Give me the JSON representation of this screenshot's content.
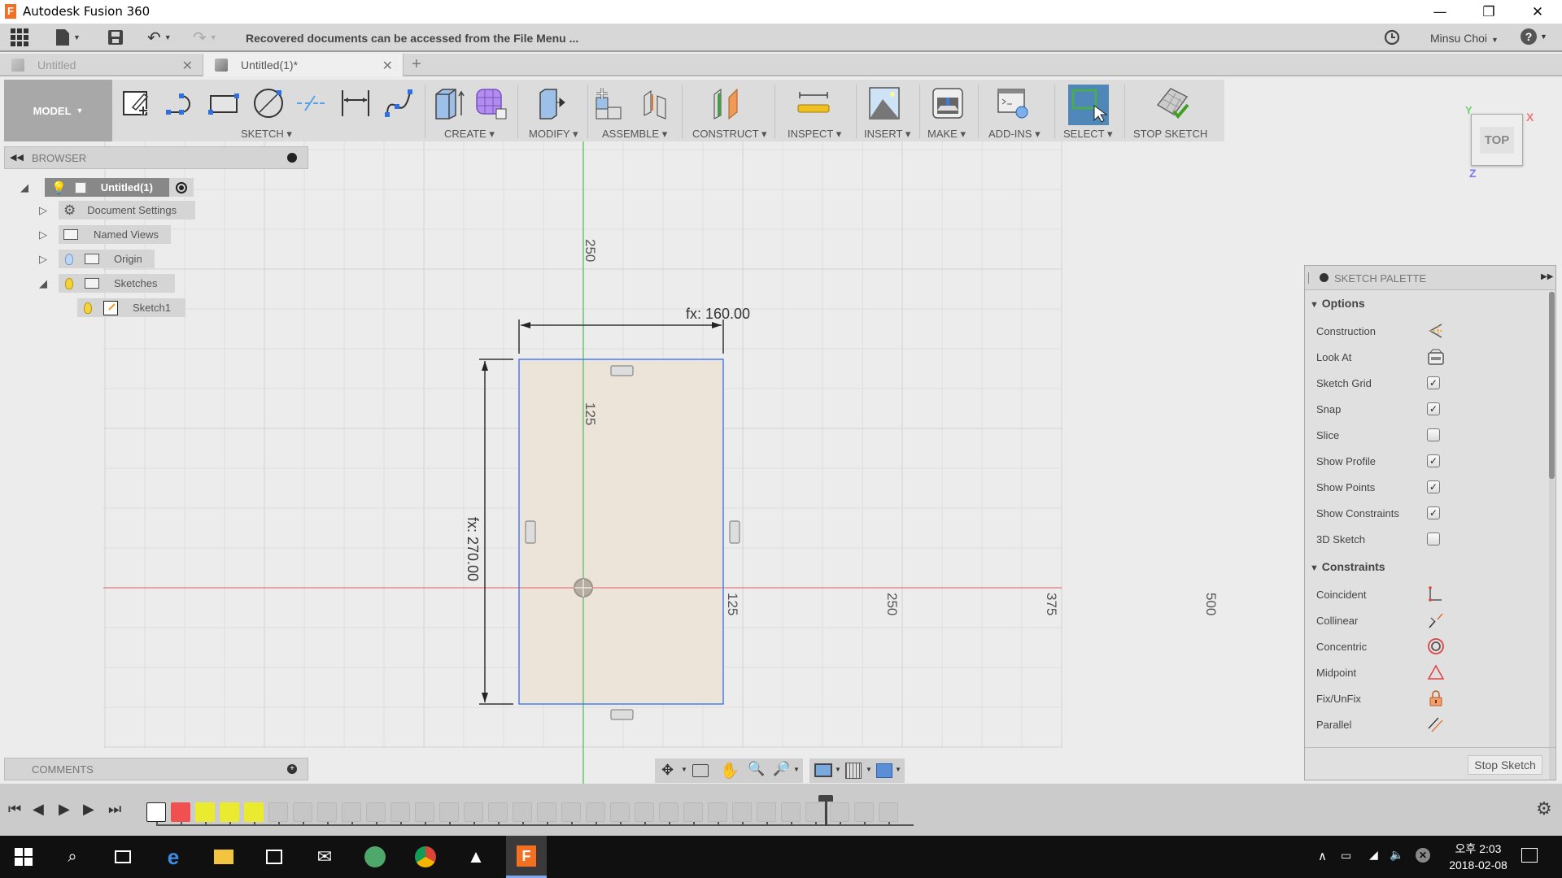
{
  "window": {
    "title": "Autodesk Fusion 360",
    "app_icon_letter": "F",
    "minimize": "—",
    "restore": "❐",
    "close": "✕"
  },
  "appbar": {
    "message": "Recovered documents can be accessed from the File Menu ...",
    "user": "Minsu Choi",
    "help": "?"
  },
  "tabs": [
    {
      "label": "Untitled",
      "active": false
    },
    {
      "label": "Untitled(1)*",
      "active": true
    }
  ],
  "new_tab": "+",
  "toolbar": {
    "workspace": "MODEL",
    "groups": [
      "SKETCH",
      "CREATE",
      "MODIFY",
      "ASSEMBLE",
      "CONSTRUCT",
      "INSPECT",
      "INSERT",
      "MAKE",
      "ADD-INS",
      "SELECT",
      "STOP SKETCH"
    ]
  },
  "browser": {
    "title": "BROWSER",
    "items": [
      {
        "label": "Untitled(1)",
        "level": 0,
        "expanded": true
      },
      {
        "label": "Document Settings",
        "level": 1,
        "expanded": false
      },
      {
        "label": "Named Views",
        "level": 1,
        "expanded": false
      },
      {
        "label": "Origin",
        "level": 1,
        "expanded": false
      },
      {
        "label": "Sketches",
        "level": 1,
        "expanded": true
      },
      {
        "label": "Sketch1",
        "level": 2
      }
    ]
  },
  "comments": {
    "title": "COMMENTS"
  },
  "viewcube": {
    "face": "TOP",
    "x": "X",
    "y": "Y",
    "z": "Z"
  },
  "sketch": {
    "width_dim": "fx: 160.00",
    "height_dim": "fx: 270.00",
    "grid_labels_x": [
      "125",
      "250",
      "375",
      "500"
    ],
    "grid_labels_y": [
      "125",
      "250"
    ],
    "colors": {
      "x_axis": "#e06060",
      "y_axis": "#6cc46c",
      "profile": "#ece3d8",
      "outline": "#4a7df0"
    }
  },
  "palette": {
    "title": "SKETCH PALETTE",
    "options_title": "Options",
    "options": [
      {
        "label": "Construction",
        "type": "icon",
        "icon": "construction-icon"
      },
      {
        "label": "Look At",
        "type": "icon",
        "icon": "look-at-icon"
      },
      {
        "label": "Sketch Grid",
        "type": "checkbox",
        "checked": true
      },
      {
        "label": "Snap",
        "type": "checkbox",
        "checked": true
      },
      {
        "label": "Slice",
        "type": "checkbox",
        "checked": false
      },
      {
        "label": "Show Profile",
        "type": "checkbox",
        "checked": true
      },
      {
        "label": "Show Points",
        "type": "checkbox",
        "checked": true
      },
      {
        "label": "Show Constraints",
        "type": "checkbox",
        "checked": true
      },
      {
        "label": "3D Sketch",
        "type": "checkbox",
        "checked": false
      }
    ],
    "constraints_title": "Constraints",
    "constraints": [
      {
        "label": "Coincident",
        "icon": "coincident-icon"
      },
      {
        "label": "Collinear",
        "icon": "collinear-icon"
      },
      {
        "label": "Concentric",
        "icon": "concentric-icon"
      },
      {
        "label": "Midpoint",
        "icon": "midpoint-icon"
      },
      {
        "label": "Fix/UnFix",
        "icon": "lock-icon"
      },
      {
        "label": "Parallel",
        "icon": "parallel-icon"
      }
    ],
    "stop_button": "Stop Sketch"
  },
  "taskbar": {
    "time": "오후 2:03",
    "date": "2018-02-08"
  }
}
